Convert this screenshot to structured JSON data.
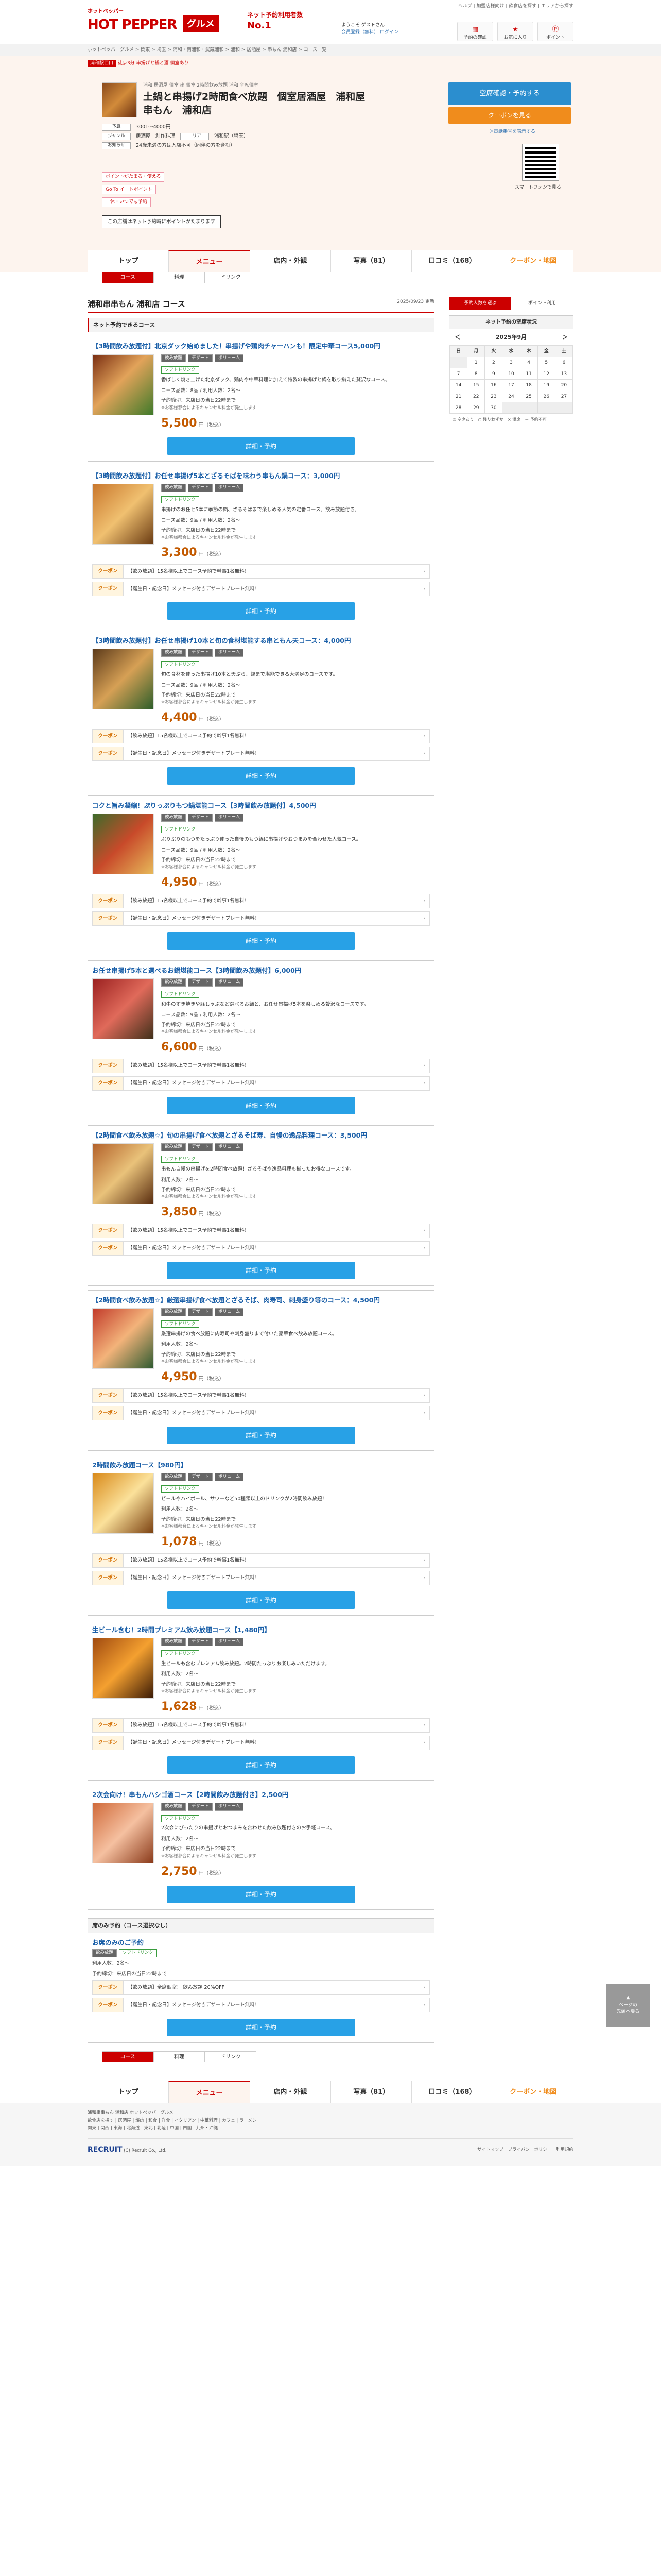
{
  "brand": {
    "small": "ホットペッパー",
    "main": "HOT PEPPER",
    "gourmet": "グルメ",
    "no1_line1": "ネット予約利用者数",
    "no1_line2": "No.1"
  },
  "header": {
    "links": "ヘルプ | 加盟店様向け | 飲食店を探す | エリアから探す",
    "greet_line1": "ようこそ ゲストさん",
    "greet_line2": "会員登録（無料） ログイン",
    "btn_reserve": "予約の確認",
    "btn_fav": "お気に入り",
    "btn_point": "ポイント"
  },
  "crumbs": "ホットペッパーグルメ > 関東 > 埼玉 > 浦和・南浦和・武蔵浦和 > 浦和 > 居酒屋 > 串もん 浦和店 > コース一覧",
  "shop": {
    "tag": "浦和駅西口",
    "tag_text": "徒歩3分 串揚げと鍋と酒 個室あり",
    "sub": "浦和 居酒屋 個室 串 個室 2時間飲み放題 浦和 全席個室",
    "name": "土鍋と串揚げ2時間食べ放題　個室居酒屋　浦和屋 串もん　浦和店",
    "reserve": "空席確認・予約する",
    "coupon": "クーポンを見る",
    "reserve_note": "＞電話番号を表示する",
    "qr_note": "スマートフォンで見る",
    "meta": [
      {
        "label": "予算",
        "value": "3001～4000円"
      },
      {
        "label": "ジャンル",
        "value": "居酒屋　創作料理"
      },
      {
        "label": "エリア",
        "value": "浦和駅（埼玉）"
      },
      {
        "label": "お知らせ",
        "value": "24歳未満の方は入店不可（同伴の方を含む）"
      }
    ],
    "badges": [
      "ポイントがたまる・使える",
      "Go To イートポイント",
      "一休・いつでも予約"
    ],
    "point": "この店舗はネット予約時にポイントがたまります"
  },
  "tabs": [
    "トップ",
    "メニュー",
    "店内・外観",
    "写真（81）",
    "口コミ（168）",
    "クーポン・地図"
  ],
  "subtabs": [
    "コース",
    "料理",
    "ドリンク"
  ],
  "page": {
    "title": "浦和串串もん 浦和店 コース",
    "updated": "2025/09/23 更新",
    "sec": "ネット予約できるコース"
  },
  "courses": [
    {
      "title": "【3時間飲み放題付】北京ダック始めました！串揚げや鶏肉チャーハンも！限定中華コース5,000円",
      "desc": "香ばしく焼き上げた北京ダック、鶏肉や中華料理に加えて特製の串揚げと鍋を取り揃えた贅沢なコース。",
      "people": "コース品数：8品 / 利用人数：2名～",
      "rule": "予約締切：来店日の当日22時まで",
      "note": "※お客様都合によるキャンセル料金が発生します",
      "price": "5,500",
      "coupons": []
    },
    {
      "title": "【3時間飲み放題付】お任せ串揚げ5本とざるそばを味わう串もん鍋コース：3,000円",
      "desc": "串揚げのお任せ5本に季節の鍋、ざるそばまで楽しめる人気の定番コース。飲み放題付き。",
      "people": "コース品数：9品 / 利用人数：2名～",
      "rule": "予約締切：来店日の当日22時まで",
      "note": "※お客様都合によるキャンセル料金が発生します",
      "price": "3,300",
      "coupons": [
        "【飲み放題】15名様以上でコース予約で幹事1名無料！",
        "【誕生日・記念日】メッセージ付きデザートプレート無料！"
      ]
    },
    {
      "title": "【3時間飲み放題付】お任せ串揚げ10本と旬の食材堪能する串ともん天コース：4,000円",
      "desc": "旬の食材を使った串揚げ10本と天ぷら、鍋まで堪能できる大満足のコースです。",
      "people": "コース品数：9品 / 利用人数：2名～",
      "rule": "予約締切：来店日の当日22時まで",
      "note": "※お客様都合によるキャンセル料金が発生します",
      "price": "4,400",
      "coupons": [
        "【飲み放題】15名様以上でコース予約で幹事1名無料！",
        "【誕生日・記念日】メッセージ付きデザートプレート無料！"
      ]
    },
    {
      "title": "コクと旨み凝縮！ぷりっぷりもつ鍋堪能コース【3時間飲み放題付】4,500円",
      "desc": "ぷりぷりのもつをたっぷり使った自慢のもつ鍋に串揚げやおつまみを合わせた人気コース。",
      "people": "コース品数：9品 / 利用人数：2名～",
      "rule": "予約締切：来店日の当日22時まで",
      "note": "※お客様都合によるキャンセル料金が発生します",
      "price": "4,950",
      "coupons": [
        "【飲み放題】15名様以上でコース予約で幹事1名無料！",
        "【誕生日・記念日】メッセージ付きデザートプレート無料！"
      ]
    },
    {
      "title": "お任せ串揚げ5本と選べるお鍋堪能コース【3時間飲み放題付】6,000円",
      "desc": "和牛のすき焼きや豚しゃぶなど選べるお鍋と、お任せ串揚げ5本を楽しめる贅沢なコースです。",
      "people": "コース品数：9品 / 利用人数：2名～",
      "rule": "予約締切：来店日の当日22時まで",
      "note": "※お客様都合によるキャンセル料金が発生します",
      "price": "6,600",
      "coupons": [
        "【飲み放題】15名様以上でコース予約で幹事1名無料！",
        "【誕生日・記念日】メッセージ付きデザートプレート無料！"
      ]
    },
    {
      "title": "【2時間食べ飲み放題☆】旬の串揚げ食べ放題とざるそば寿、自慢の逸品料理コース：3,500円",
      "desc": "串もん自慢の串揚げを2時間食べ放題！ざるそばや逸品料理も揃ったお得なコースです。",
      "people": "利用人数：2名～",
      "rule": "予約締切：来店日の当日22時まで",
      "note": "※お客様都合によるキャンセル料金が発生します",
      "price": "3,850",
      "coupons": [
        "【飲み放題】15名様以上でコース予約で幹事1名無料！",
        "【誕生日・記念日】メッセージ付きデザートプレート無料！"
      ]
    },
    {
      "title": "【2時間食べ飲み放題☆】厳選串揚げ食べ放題とざるそば、肉寿司、刺身盛り等のコース：4,500円",
      "desc": "厳選串揚げの食べ放題に肉寿司や刺身盛りまで付いた豪華食べ飲み放題コース。",
      "people": "利用人数：2名～",
      "rule": "予約締切：来店日の当日22時まで",
      "note": "※お客様都合によるキャンセル料金が発生します",
      "price": "4,950",
      "coupons": [
        "【飲み放題】15名様以上でコース予約で幹事1名無料！",
        "【誕生日・記念日】メッセージ付きデザートプレート無料！"
      ]
    },
    {
      "title": "2時間飲み放題コース【980円】",
      "desc": "ビールやハイボール、サワーなど50種類以上のドリンクが2時間飲み放題！",
      "people": "利用人数：2名～",
      "rule": "予約締切：来店日の当日22時まで",
      "note": "※お客様都合によるキャンセル料金が発生します",
      "price": "1,078",
      "coupons": [
        "【飲み放題】15名様以上でコース予約で幹事1名無料！",
        "【誕生日・記念日】メッセージ付きデザートプレート無料！"
      ]
    },
    {
      "title": "生ビール含む！2時間プレミアム飲み放題コース【1,480円】",
      "desc": "生ビールも含むプレミアム飲み放題。2時間たっぷりお楽しみいただけます。",
      "people": "利用人数：2名～",
      "rule": "予約締切：来店日の当日22時まで",
      "note": "※お客様都合によるキャンセル料金が発生します",
      "price": "1,628",
      "coupons": [
        "【飲み放題】15名様以上でコース予約で幹事1名無料！",
        "【誕生日・記念日】メッセージ付きデザートプレート無料！"
      ]
    },
    {
      "title": "2次会向け！串もんハシゴ酒コース【2時間飲み放題付き】2,500円",
      "desc": "2次会にぴったりの串揚げとおつまみを合わせた飲み放題付きのお手軽コース。",
      "people": "利用人数：2名～",
      "rule": "予約締切：来店日の当日22時まで",
      "note": "※お客様都合によるキャンセル料金が発生します",
      "price": "2,750",
      "coupons": []
    }
  ],
  "tag_labels": {
    "t1": "飲み放題",
    "t2": "デザート",
    "t3": "ボリューム",
    "g": "ソフトドリンク"
  },
  "price_unit": "円（税込）",
  "detail_label": "詳細・予約",
  "coupon_label": "クーポン",
  "seat": {
    "head": "席のみ予約（コース選択なし）",
    "title": "お席のみのご予約",
    "people": "利用人数：2名～",
    "rule": "予約締切：来店日の当日22時まで",
    "c1": "【飲み放題】全席個室！ 飲み放題 20%OFF",
    "c2": "【誕生日・記念日】メッセージ付きデザートプレート無料！"
  },
  "side": {
    "btn1": "予約人数を選ぶ",
    "btn2": "ポイント利用",
    "title": "ネット予約の空席状況",
    "month": "2025年9月",
    "prev": "＜",
    "next": "＞",
    "week": [
      "日",
      "月",
      "火",
      "水",
      "木",
      "金",
      "土"
    ],
    "days": [
      [
        "",
        "1",
        "2",
        "3",
        "4",
        "5",
        "6"
      ],
      [
        "7",
        "8",
        "9",
        "10",
        "11",
        "12",
        "13"
      ],
      [
        "14",
        "15",
        "16",
        "17",
        "18",
        "19",
        "20"
      ],
      [
        "21",
        "22",
        "23",
        "24",
        "25",
        "26",
        "27"
      ],
      [
        "28",
        "29",
        "30",
        "",
        "",
        "",
        ""
      ]
    ],
    "legend": "◎ 空席あり　○ 残りわずか　× 満席　－ 予約不可"
  },
  "scroll": {
    "l1": "ページの",
    "l2": "先頭へ戻る"
  },
  "footer": {
    "l1": "浦和串串もん 浦和店 ホットペッパーグルメ",
    "l2": "飲食店を探す | 居酒屋 | 焼肉 | 和食 | 洋食 | イタリアン | 中華料理 | カフェ | ラーメン",
    "l3": "関東 | 関西 | 東海 | 北海道 | 東北 | 北陸 | 中国 | 四国 | 九州・沖縄",
    "copy": "(C) Recruit Co., Ltd.",
    "rec": "RECRUIT",
    "right": "サイトマップ　プライバシーポリシー　利用規約"
  }
}
